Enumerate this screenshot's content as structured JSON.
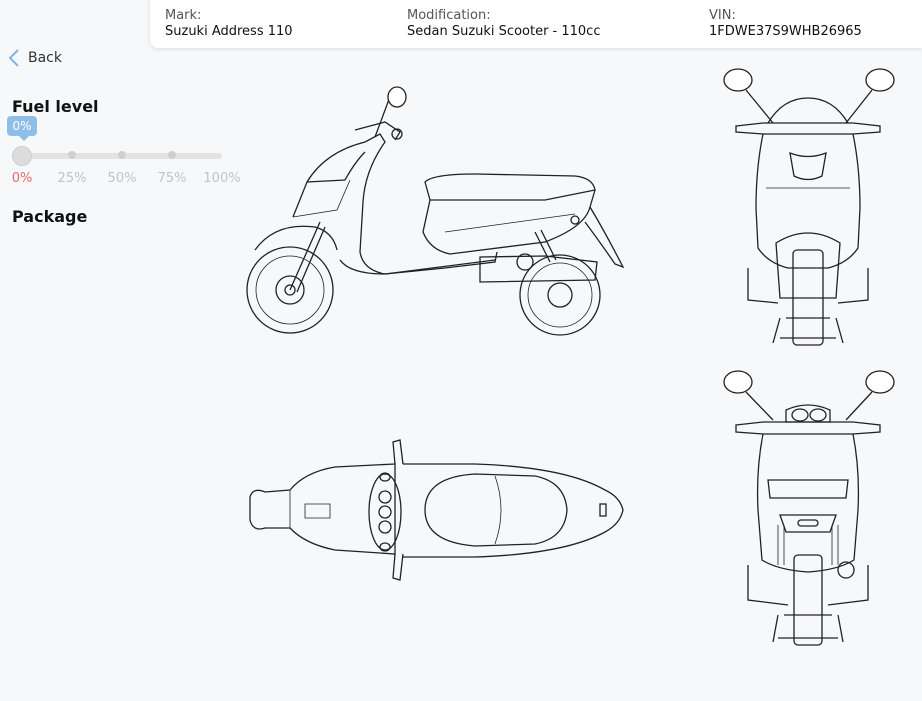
{
  "header": {
    "mark": {
      "label": "Mark:",
      "value": "Suzuki Address 110"
    },
    "modification": {
      "label": "Modification:",
      "value": "Sedan Suzuki Scooter - 110cc"
    },
    "vin": {
      "label": "VIN:",
      "value": "1FDWE37S9WHB26965"
    }
  },
  "nav": {
    "back_label": "Back"
  },
  "fuel": {
    "title": "Fuel level",
    "current": "0%",
    "level": 0,
    "ticks": [
      "0%",
      "25%",
      "50%",
      "75%",
      "100%"
    ]
  },
  "package": {
    "title": "Package"
  },
  "colors": {
    "accent": "#8fbfe9",
    "active_tick": "#e36a6a"
  }
}
